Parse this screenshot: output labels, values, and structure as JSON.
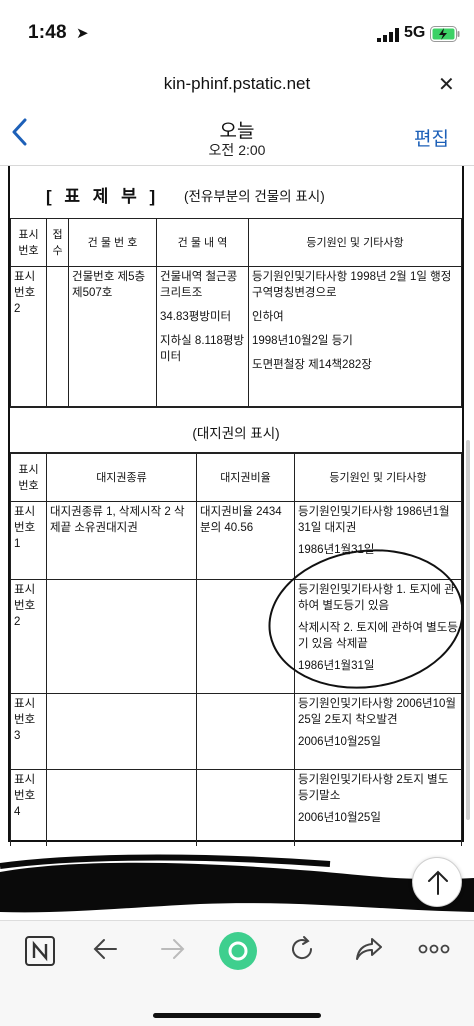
{
  "status": {
    "time": "1:48",
    "network": "5G"
  },
  "url": "kin-phinf.pstatic.net",
  "nav": {
    "title": "오늘",
    "subtitle": "오전 2:00",
    "edit": "편집"
  },
  "doc": {
    "section1": {
      "bracket": "[ 표 제 부 ]",
      "paren": "(전유부분의 건물의 표시)",
      "headers": [
        "표시번호",
        "접수",
        "건 물 번 호",
        "건 물 내 역",
        "등기원인 및 기타사항"
      ],
      "row": {
        "no": "표시번호 2",
        "receipt": "",
        "bldg_no": "건물번호 제5층 제507호",
        "details": [
          "건물내역 철근콩크리트조",
          "34.83평방미터",
          "지하실 8.118평방미터"
        ],
        "cause": [
          "등기원인및기타사항 1998년 2월 1일 행정구역명칭변경으로",
          "인하여",
          "1998년10월2일 등기",
          "도면편철장 제14책282장"
        ]
      }
    },
    "section2": {
      "title": "(대지권의 표시)",
      "headers": [
        "표시번호",
        "대지권종류",
        "대지권비율",
        "등기원인 및 기타사항"
      ],
      "rows": [
        {
          "no": "표시번호 1",
          "kind": "대지권종류 1, 삭제시작 2 삭제끝 소유권대지권",
          "ratio": "대지권비율 2434분의 40.56",
          "cause": [
            "등기원인및기타사항 1986년1월31일 대지권",
            "1986년1월31일"
          ]
        },
        {
          "no": "표시번호 2",
          "kind": "",
          "ratio": "",
          "cause": [
            "등기원인및기타사항 1. 토지에 관하여 별도등기 있음",
            "삭제시작 2. 토지에 관하여 별도등기 있음 삭제끝",
            "1986년1월31일"
          ]
        },
        {
          "no": "표시번호 3",
          "kind": "",
          "ratio": "",
          "cause": [
            "등기원인및기타사항 2006년10월25일 2토지 착오발견",
            "2006년10월25일"
          ]
        },
        {
          "no": "표시번호 4",
          "kind": "",
          "ratio": "",
          "cause": [
            "등기원인및기타사항 2토지 별도등기말소",
            "2006년10월25일"
          ]
        }
      ]
    }
  },
  "colors": {
    "accent": "#1d60b8",
    "green": "#3ecf8e",
    "battery": "#3cd166"
  }
}
